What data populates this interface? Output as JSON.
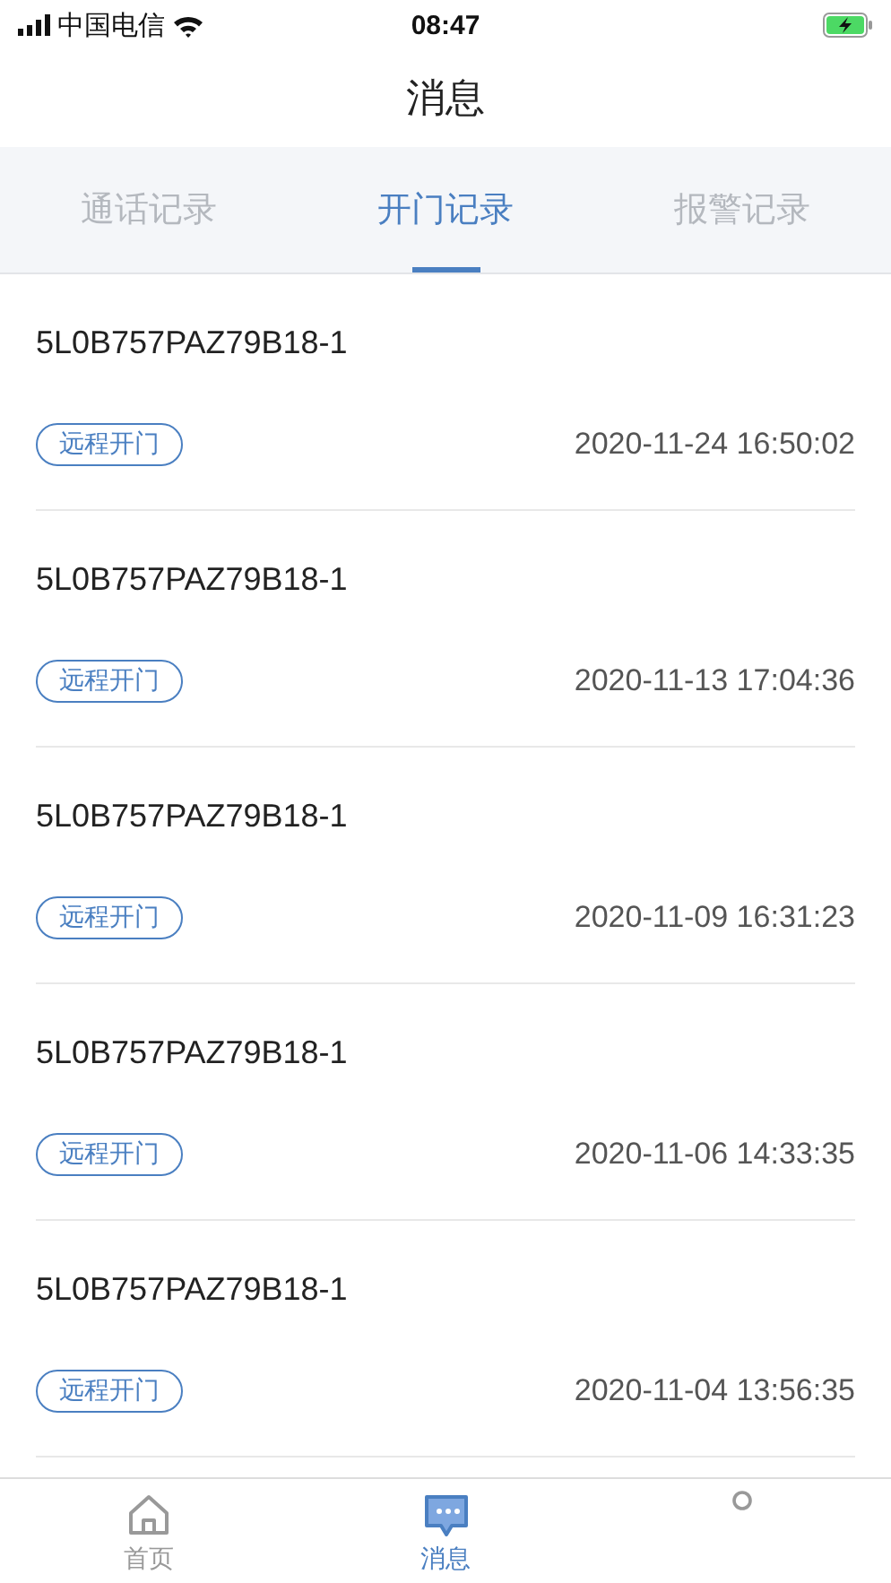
{
  "status_bar": {
    "carrier": "中国电信",
    "time": "08:47"
  },
  "title": "消息",
  "tabs": [
    {
      "label": "通话记录",
      "selected": false
    },
    {
      "label": "开门记录",
      "selected": true
    },
    {
      "label": "报警记录",
      "selected": false
    }
  ],
  "records": [
    {
      "device": "5L0B757PAZ79B18-1",
      "tag": "远程开门",
      "time": "2020-11-24 16:50:02"
    },
    {
      "device": "5L0B757PAZ79B18-1",
      "tag": "远程开门",
      "time": "2020-11-13 17:04:36"
    },
    {
      "device": "5L0B757PAZ79B18-1",
      "tag": "远程开门",
      "time": "2020-11-09 16:31:23"
    },
    {
      "device": "5L0B757PAZ79B18-1",
      "tag": "远程开门",
      "time": "2020-11-06 14:33:35"
    },
    {
      "device": "5L0B757PAZ79B18-1",
      "tag": "远程开门",
      "time": "2020-11-04 13:56:35"
    }
  ],
  "nav": [
    {
      "kind": "home",
      "label": "首页",
      "selected": false
    },
    {
      "kind": "message",
      "label": "消息",
      "selected": true
    },
    {
      "kind": "profile",
      "selected": false
    }
  ]
}
